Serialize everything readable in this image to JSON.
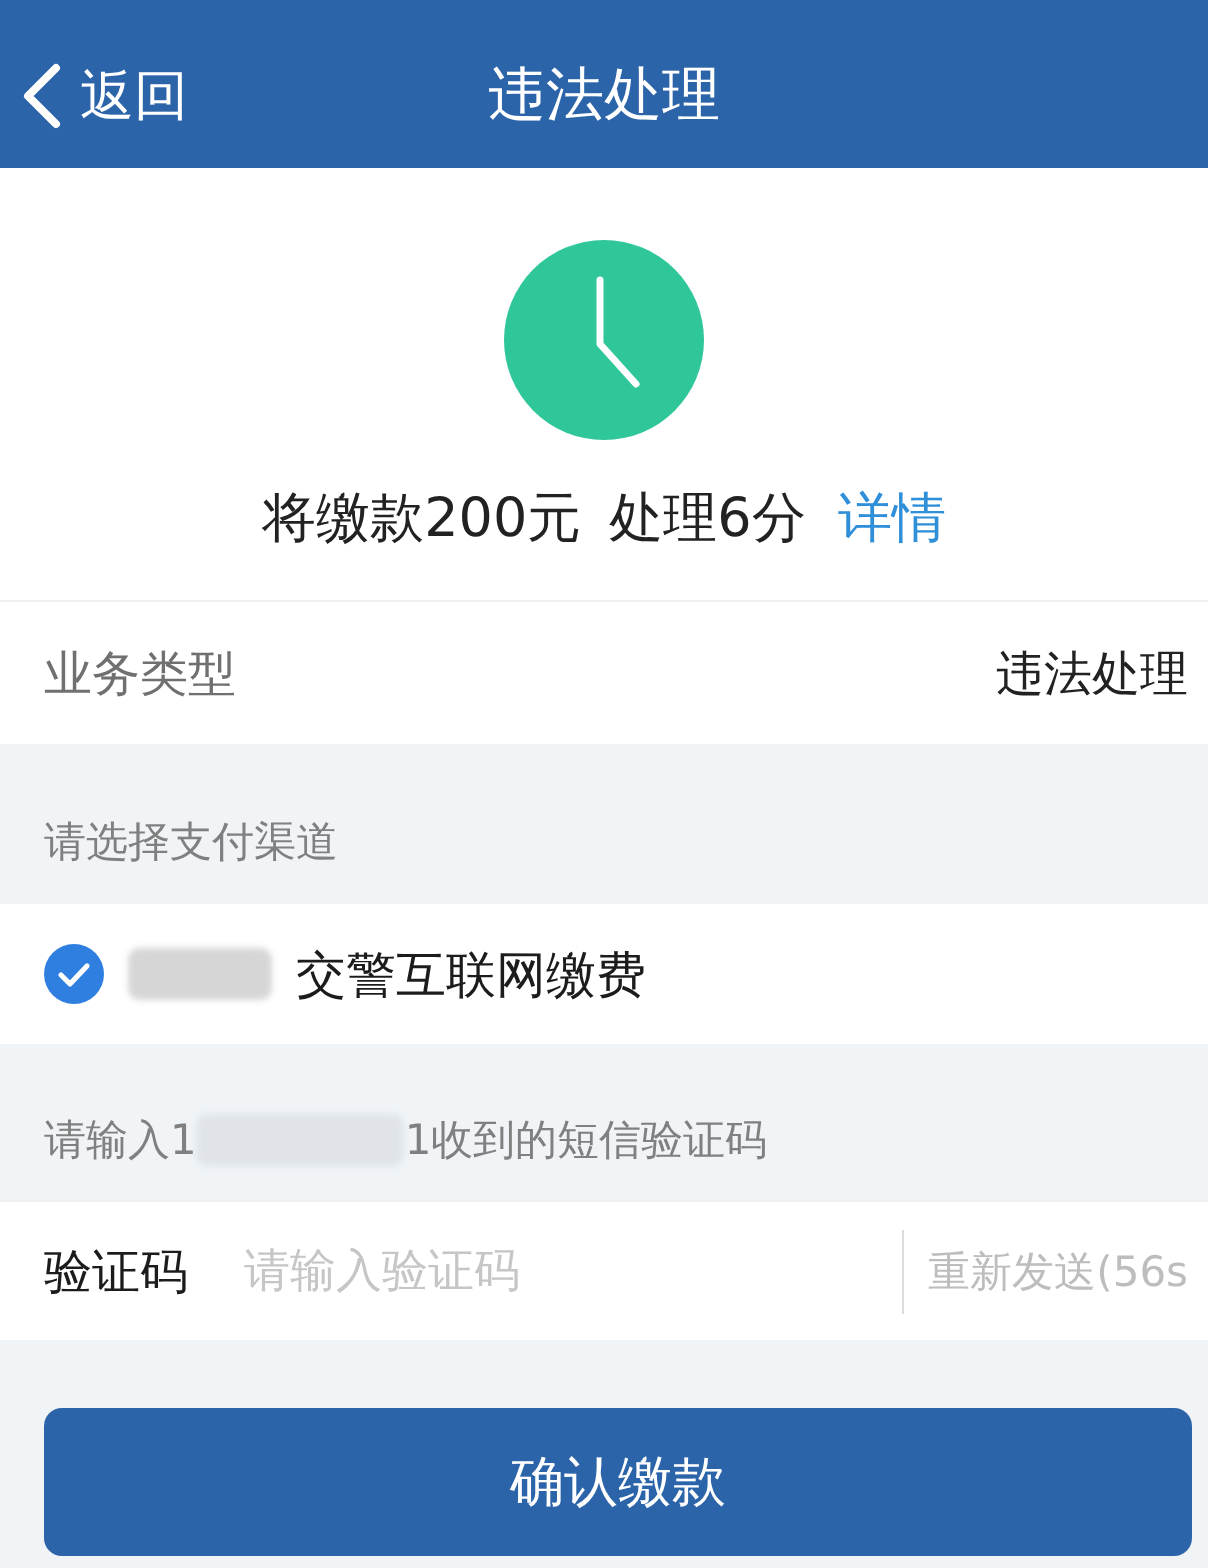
{
  "nav_bar": {
    "back_label": "返回",
    "title": "违法处理"
  },
  "summary": {
    "fine": "将缴款200元",
    "points": "处理6分",
    "link": "详情"
  },
  "business_type": {
    "label": "业务类型",
    "value": "违法处理"
  },
  "payment": {
    "heading": "请选择支付渠道",
    "channels": [
      {
        "name": "交警互联网缴费",
        "selected": true,
        "redacted": true
      }
    ]
  },
  "sms": {
    "prompt": [
      "请输入1",
      "1收到的短信验证码"
    ],
    "label": "验证码",
    "placeholder": "请输入验证码",
    "resend": "重新发送(56s"
  },
  "confirm_button": "确认缴款"
}
